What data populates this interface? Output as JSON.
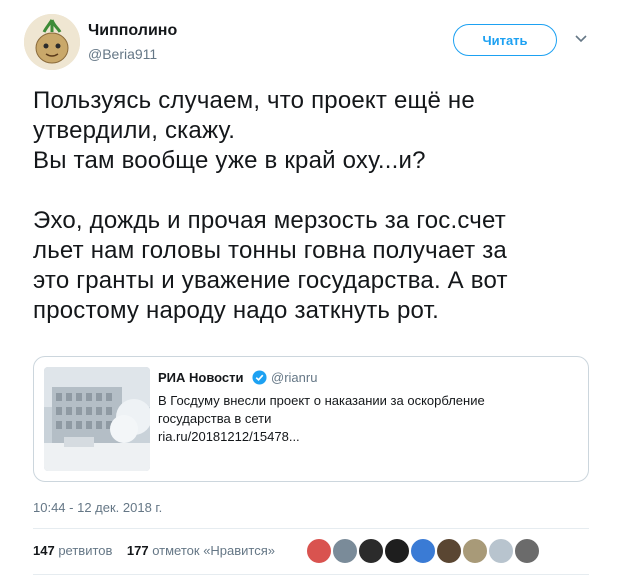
{
  "author": {
    "name": "Чипполино",
    "handle": "@Beria911"
  },
  "follow_button": {
    "label": "Читать"
  },
  "tweet": {
    "text": "Пользуясь случаем, что проект ещё не\nутвердили, скажу.\nВы там  вообще уже в край оху...и?\n\nЭхо, дождь и прочая мерзость за гос.счет\nльет нам головы тонны говна получает за\nэто гранты и уважение государства. А вот\nпростому народу надо заткнуть рот."
  },
  "quoted_tweet": {
    "name": "РИА Новости",
    "handle": "@rianru",
    "text": "В Госдуму внесли проект о наказании за оскорбление\nгосударства в сети\nria.ru/20181212/15478..."
  },
  "timestamp": "10:44 - 12 дек. 2018 г.",
  "stats": {
    "retweets_count": "147",
    "retweets_label": "ретвитов",
    "likes_count": "177",
    "likes_label": "отметок «Нравится»"
  },
  "likers": [
    {
      "icon": "avatar",
      "color": "#d9534f"
    },
    {
      "icon": "avatar",
      "color": "#7a8b99"
    },
    {
      "icon": "avatar",
      "color": "#2b2b2b"
    },
    {
      "icon": "avatar",
      "color": "#1e1e1e"
    },
    {
      "icon": "avatar",
      "color": "#3a7bd5"
    },
    {
      "icon": "avatar",
      "color": "#5a4632"
    },
    {
      "icon": "avatar",
      "color": "#a89a78"
    },
    {
      "icon": "avatar",
      "color": "#b8c4ce"
    },
    {
      "icon": "avatar",
      "color": "#6b6b6b"
    }
  ],
  "colors": {
    "accent": "#1da1f2",
    "secondary_text": "#657786",
    "border": "#ccd6dd"
  }
}
